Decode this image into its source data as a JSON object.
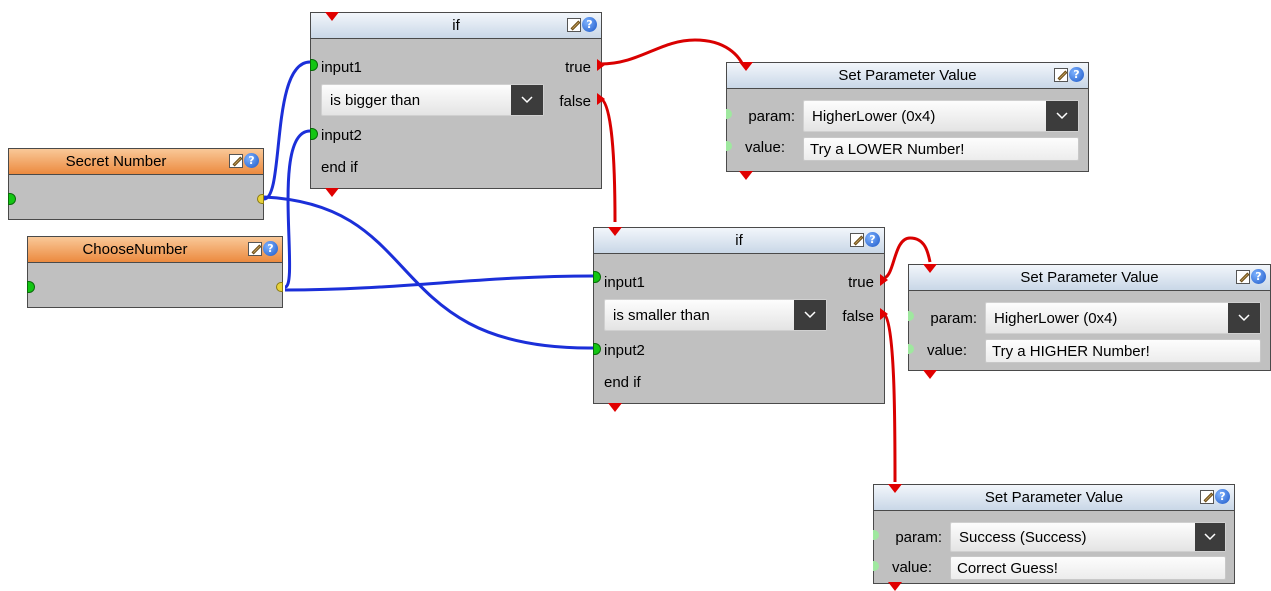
{
  "icons": {
    "edit": "edit-icon",
    "help": "help-icon",
    "dropdown": "chevron-down-icon"
  },
  "colors": {
    "flow_wire": "#d90000",
    "data_wire": "#1b2fd9",
    "variable_header": "#ec8a3f",
    "action_header": "#c9d7e7",
    "node_body": "#c0c0c0"
  },
  "nodes": {
    "if1": {
      "title": "if",
      "input1": "input1",
      "input2": "input2",
      "condition": "is bigger than",
      "end": "end if",
      "true_label": "true",
      "false_label": "false"
    },
    "if2": {
      "title": "if",
      "input1": "input1",
      "input2": "input2",
      "condition": "is smaller than",
      "end": "end if",
      "true_label": "true",
      "false_label": "false"
    },
    "secret": {
      "title": "Secret Number"
    },
    "choose": {
      "title": "ChooseNumber"
    },
    "spv1": {
      "title": "Set Parameter Value",
      "param_label": "param:",
      "value_label": "value:",
      "param": "HigherLower (0x4)",
      "value": "Try a LOWER Number!"
    },
    "spv2": {
      "title": "Set Parameter Value",
      "param_label": "param:",
      "value_label": "value:",
      "param": "HigherLower (0x4)",
      "value": "Try a HIGHER Number!"
    },
    "spv3": {
      "title": "Set Parameter Value",
      "param_label": "param:",
      "value_label": "value:",
      "param": "Success (Success)",
      "value": "Correct Guess!"
    }
  }
}
